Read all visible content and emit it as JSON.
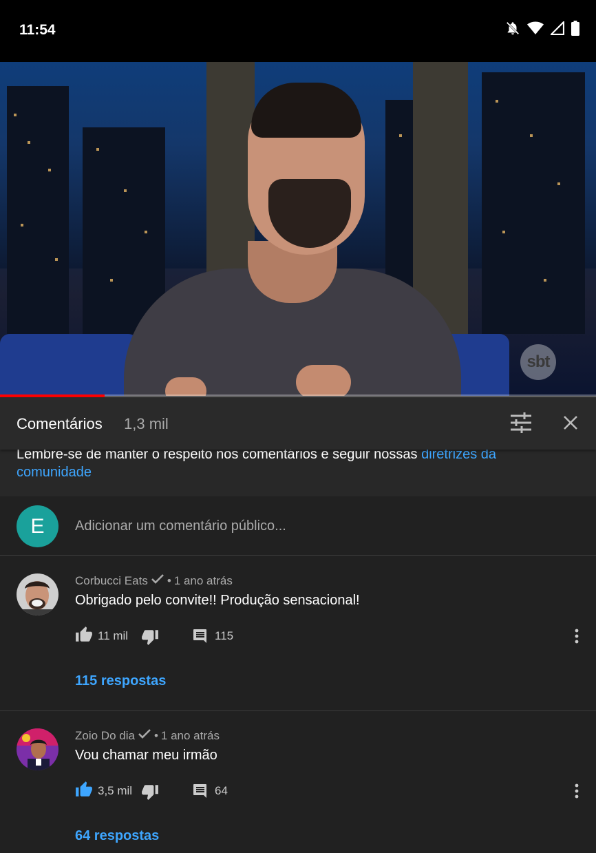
{
  "status_bar": {
    "time": "11:54",
    "icons": [
      "do-not-disturb-bell-icon",
      "wifi-icon",
      "signal-icon",
      "battery-icon"
    ]
  },
  "video": {
    "watermark": "sbt",
    "progress_fraction": 0.175
  },
  "comments_panel": {
    "title": "Comentários",
    "count": "1,3 mil",
    "notice_text": "Lembre-se de manter o respeito nos comentários e seguir nossas ",
    "notice_link": "diretrizes da comunidade",
    "add_comment": {
      "avatar_letter": "E",
      "placeholder": "Adicionar um comentário público..."
    },
    "comments": [
      {
        "author": "Corbucci Eats",
        "verified": true,
        "separator": "•",
        "time": "1 ano atrás",
        "text": "Obrigado pelo convite!! Produção sensacional!",
        "likes": "11 mil",
        "liked": false,
        "reply_count": "115",
        "replies_label": "115 respostas"
      },
      {
        "author": "Zoio Do dia",
        "verified": true,
        "separator": "•",
        "time": "1 ano atrás",
        "text": "Vou chamar meu irmão",
        "likes": "3,5 mil",
        "liked": true,
        "reply_count": "64",
        "replies_label": "64 respostas"
      }
    ]
  },
  "colors": {
    "accent_blue": "#3ea6ff",
    "progress_red": "#ff0000",
    "avatar_teal": "#1aa19b",
    "background": "#212121"
  }
}
